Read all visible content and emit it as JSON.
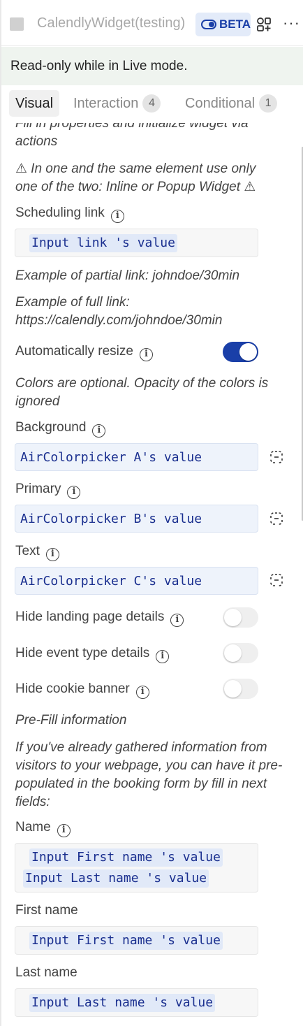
{
  "header": {
    "title": "CalendlyWidget(testing)",
    "beta_label": "BETA",
    "more_label": "···"
  },
  "notice": "Read-only while in Live mode.",
  "tabs": [
    {
      "label": "Visual",
      "active": true
    },
    {
      "label": "Interaction",
      "badge": "4"
    },
    {
      "label": "Conditional",
      "badge": "1"
    }
  ],
  "content": {
    "intro_partial": "Fill in properties and initialize widget via actions",
    "warning": "⚠ In one and the same element use only one of the two: Inline or Popup Widget ⚠",
    "scheduling_link": {
      "label": "Scheduling link",
      "value": "Input link 's value"
    },
    "example_partial": "Example of partial link: johndoe/30min",
    "example_full": "Example of full link: https://calendly.com/johndoe/30min",
    "auto_resize": {
      "label": "Automatically resize",
      "on": true
    },
    "colors_note": "Colors are optional. Opacity of the colors is ignored",
    "background": {
      "label": "Background",
      "value": "AirColorpicker A's value"
    },
    "primary": {
      "label": "Primary",
      "value": "AirColorpicker B's value"
    },
    "text": {
      "label": "Text",
      "value": "AirColorpicker C's value"
    },
    "hide_landing": {
      "label": "Hide landing page details",
      "on": false
    },
    "hide_event": {
      "label": "Hide event type details",
      "on": false
    },
    "hide_cookie": {
      "label": "Hide cookie banner",
      "on": false
    },
    "prefill_title": "Pre-Fill information",
    "prefill_desc": "If you've already gathered information from visitors to your webpage, you can have it pre-populated in the booking form by fill in next fields:",
    "name": {
      "label": "Name",
      "value_1": "Input First name 's value",
      "value_2": "Input Last name 's value"
    },
    "first_name": {
      "label": "First name",
      "value": "Input First name 's value"
    },
    "last_name": {
      "label": "Last name",
      "value": "Input Last name 's value"
    }
  },
  "colors": {
    "accent": "#1a3fa8",
    "chip_bg": "#e1e9f8",
    "chip_text": "#1a2f8f",
    "notice_bg": "#eff4ef"
  },
  "icons": [
    "component-icon",
    "more-icon",
    "info-icon",
    "unlink-icon",
    "toggle-icon"
  ]
}
